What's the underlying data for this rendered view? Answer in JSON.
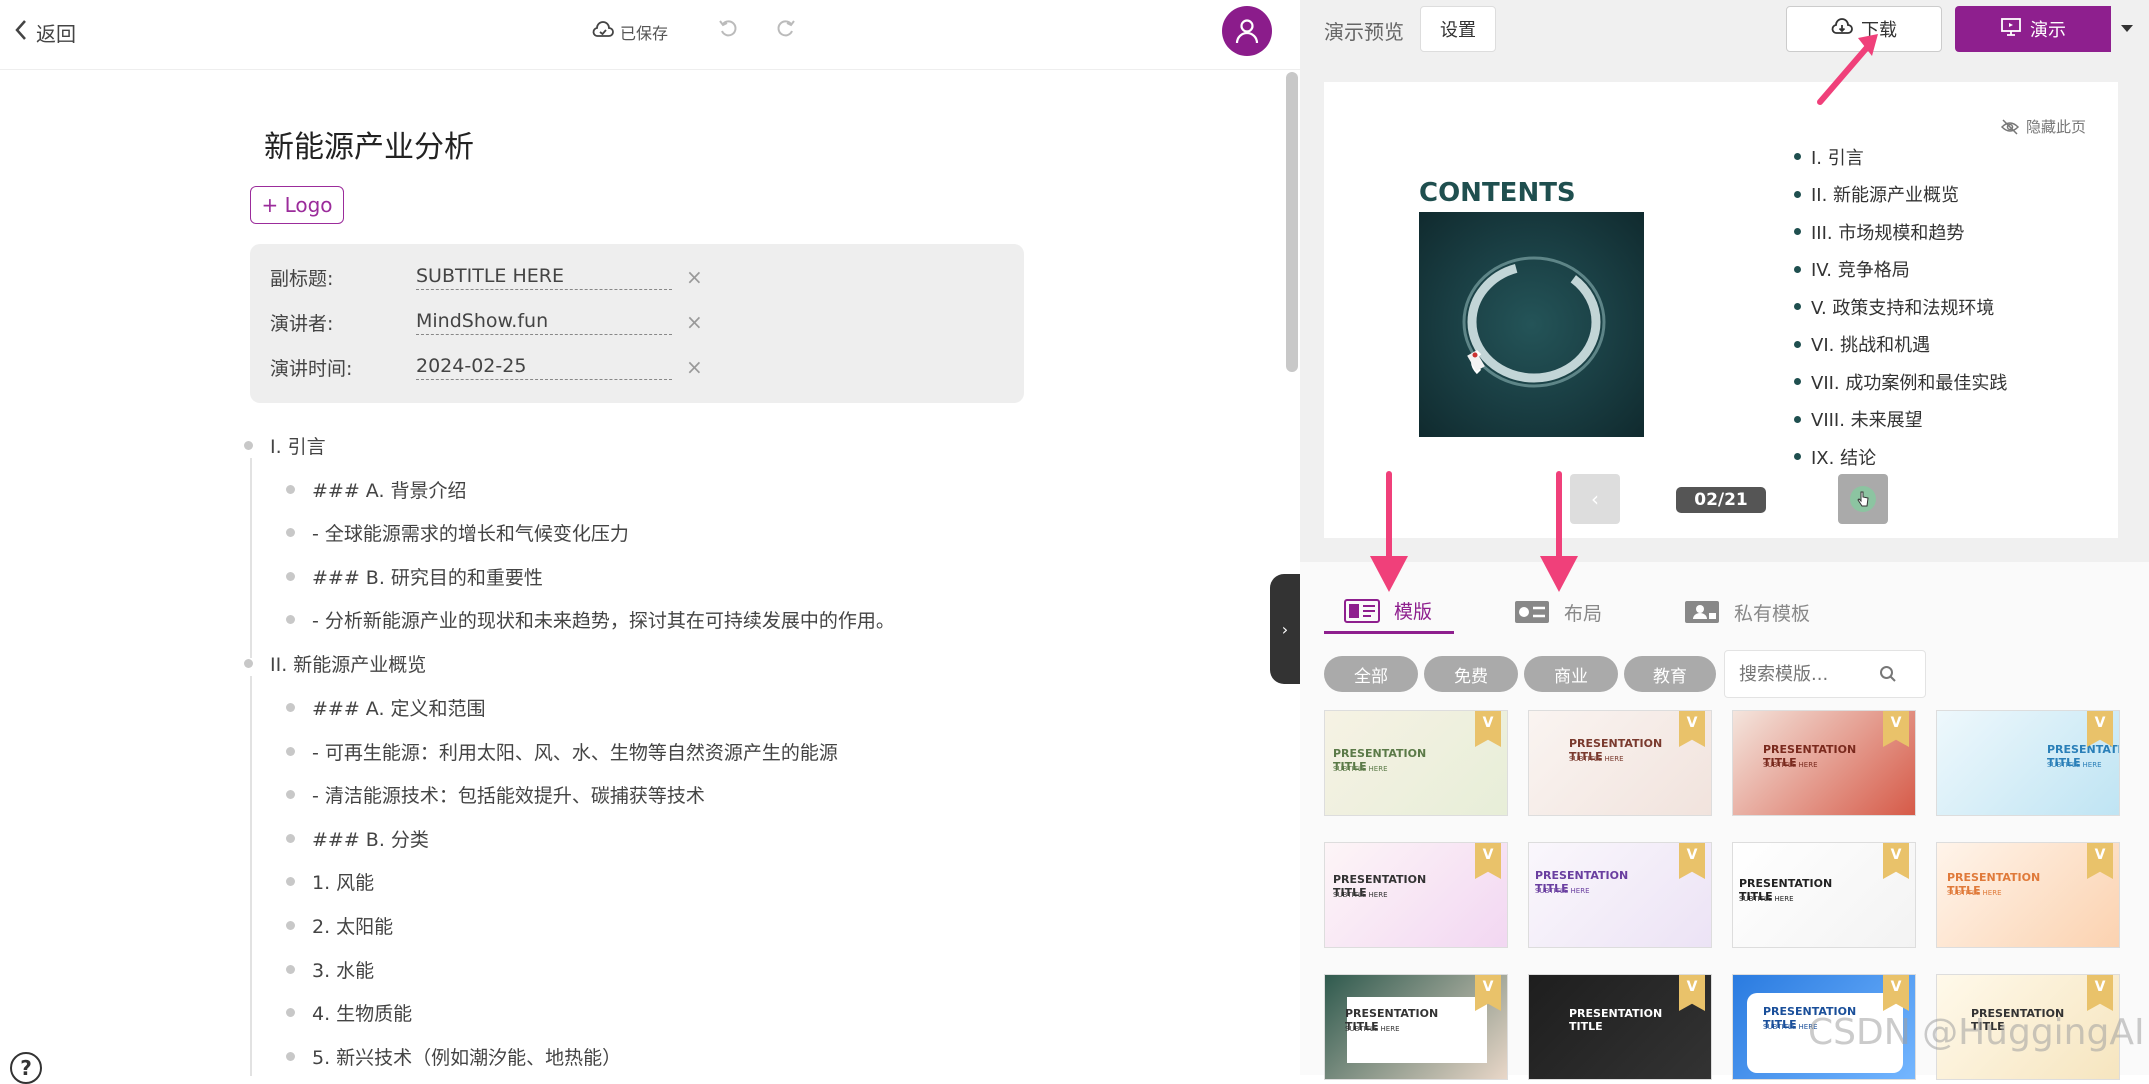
{
  "editor": {
    "back_label": "返回",
    "saved_label": "已保存",
    "doc_title": "新能源产业分析",
    "logo_button": "+ Logo",
    "meta": [
      {
        "label": "副标题:",
        "value": "SUBTITLE HERE"
      },
      {
        "label": "演讲者:",
        "value": "MindShow.fun"
      },
      {
        "label": "演讲时间:",
        "value": "2024-02-25"
      }
    ],
    "clear_glyph": "×",
    "outline": [
      {
        "level": 1,
        "text": "I. 引言"
      },
      {
        "level": 2,
        "text": "### A. 背景介绍"
      },
      {
        "level": 2,
        "text": "- 全球能源需求的增长和气候变化压力"
      },
      {
        "level": 2,
        "text": "### B. 研究目的和重要性"
      },
      {
        "level": 2,
        "text": "- 分析新能源产业的现状和未来趋势，探讨其在可持续发展中的作用。"
      },
      {
        "level": 1,
        "text": "II. 新能源产业概览"
      },
      {
        "level": 2,
        "text": "### A. 定义和范围"
      },
      {
        "level": 2,
        "text": "- 可再生能源：利用太阳、风、水、生物等自然资源产生的能源"
      },
      {
        "level": 2,
        "text": "- 清洁能源技术：包括能效提升、碳捕获等技术"
      },
      {
        "level": 2,
        "text": "### B. 分类"
      },
      {
        "level": 2,
        "text": "1. 风能"
      },
      {
        "level": 2,
        "text": "2. 太阳能"
      },
      {
        "level": 2,
        "text": "3. 水能"
      },
      {
        "level": 2,
        "text": "4. 生物质能"
      },
      {
        "level": 2,
        "text": "5. 新兴技术（例如潮汐能、地热能）"
      }
    ],
    "help_glyph": "?"
  },
  "preview": {
    "label": "演示预览",
    "settings_button": "设置",
    "download_button": "下载",
    "present_button": "演示",
    "hide_page": "隐藏此页",
    "slide_heading": "CONTENTS",
    "toc": [
      "I. 引言",
      "II. 新能源产业概览",
      "III. 市场规模和趋势",
      "IV. 竞争格局",
      "V. 政策支持和法规环境",
      "VI. 挑战和机遇",
      "VII. 成功案例和最佳实践",
      "VIII. 未来展望",
      "IX. 结论"
    ],
    "page_indicator": "02/21"
  },
  "templates": {
    "tabs": [
      "模版",
      "布局",
      "私有模板"
    ],
    "active_tab": "模版",
    "filters": [
      "全部",
      "免费",
      "商业",
      "教育"
    ],
    "search_placeholder": "搜索模版...",
    "thumbnails": [
      {
        "title": "PRESENTATION TITLE",
        "subtitle": "SUBTITLE HERE",
        "badge": "V"
      },
      {
        "title": "PRESENTATION TITLE",
        "subtitle": "SUBTITLE HERE",
        "badge": "V"
      },
      {
        "title": "PRESENTATION TITLE",
        "subtitle": "SUBTITLE HERE",
        "badge": "V"
      },
      {
        "title": "PRESENTATION TITLE",
        "subtitle": "SUBTITLE HERE",
        "badge": "V"
      },
      {
        "title": "PRESENTATION TITLE",
        "subtitle": "SUBTITLE HERE",
        "badge": "V"
      },
      {
        "title": "PRESENTATION TITLE",
        "subtitle": "SUBTITLE HERE",
        "badge": "V"
      },
      {
        "title": "PRESENTATION TITLE",
        "subtitle": "SUBTITLE HERE",
        "badge": "V"
      },
      {
        "title": "PRESENTATION TITLE",
        "subtitle": "SUBTITLE HERE",
        "badge": "V"
      },
      {
        "title": "PRESENTATION TITLE",
        "subtitle": "SUBTITLE HERE",
        "badge": "V"
      },
      {
        "title": "PRESENTATION TITLE",
        "subtitle": "",
        "badge": "V"
      },
      {
        "title": "PRESENTATION TITLE",
        "subtitle": "SUBTITLE HERE",
        "badge": "V"
      },
      {
        "title": "PRESENTATION TITLE",
        "subtitle": "",
        "badge": "V"
      }
    ]
  },
  "watermark": "CSDN @HuggingAI",
  "colors": {
    "brand": "#8e1f8e",
    "arrow": "#f0407a"
  }
}
